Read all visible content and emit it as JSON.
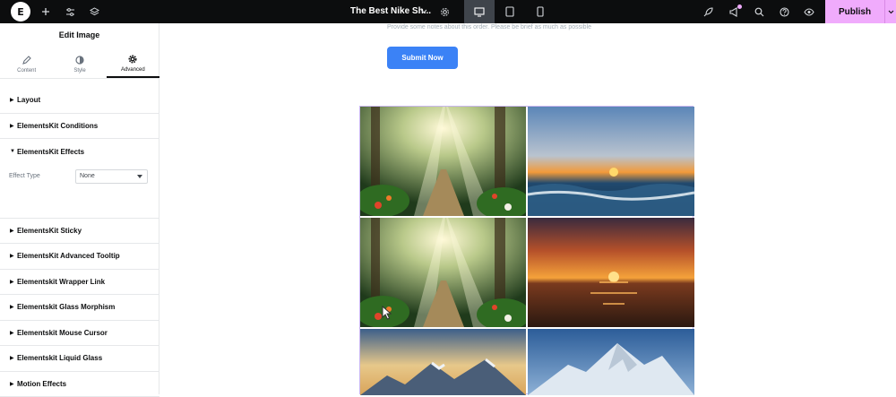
{
  "topbar": {
    "doc_title": "The Best Nike Sh...",
    "publish_label": "Publish"
  },
  "panel": {
    "title": "Edit Image",
    "tabs": [
      {
        "label": "Content",
        "icon": "pencil-icon"
      },
      {
        "label": "Style",
        "icon": "half-circle-icon"
      },
      {
        "label": "Advanced",
        "icon": "gear-icon"
      }
    ],
    "active_tab": "Advanced",
    "sections": [
      {
        "label": "Layout"
      },
      {
        "label": "ElementsKit Conditions"
      },
      {
        "label": "ElementsKit Effects"
      },
      {
        "label": "ElementsKit Sticky"
      },
      {
        "label": "ElementsKit Advanced Tooltip"
      },
      {
        "label": "Elementskit Wrapper Link"
      },
      {
        "label": "Elementskit Glass Morphism"
      },
      {
        "label": "Elementskit Mouse Cursor"
      },
      {
        "label": "Elementskit Liquid Glass"
      },
      {
        "label": "Motion Effects"
      }
    ],
    "effect_type_label": "Effect Type",
    "effect_type_value": "None"
  },
  "canvas": {
    "notes_text": "Provide some notes about this order. Please be brief as much as possible",
    "submit_label": "Submit Now"
  },
  "colors": {
    "topbar_bg": "#0c0d0e",
    "publish_bg": "#f0abfc",
    "submit_bg": "#3b82f6",
    "gallery_border": "#c9b6f0"
  }
}
